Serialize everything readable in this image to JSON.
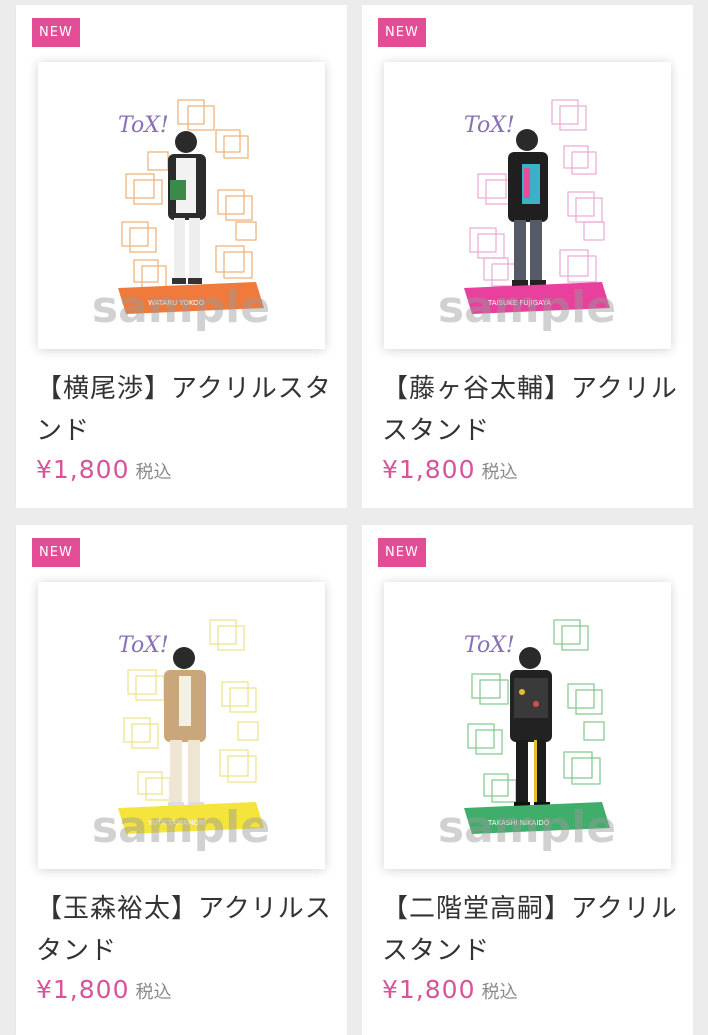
{
  "products": [
    {
      "badge": "NEW",
      "title": "【横尾渉】アクリルスタンド",
      "price": "¥1,800",
      "tax_label": "税込",
      "watermark": "sample",
      "stand_logo": "ToX!",
      "name_plate": "WATARU YOKOO",
      "accent_color": "#f07a3c",
      "pattern_color": "#e9a25d"
    },
    {
      "badge": "NEW",
      "title": "【藤ヶ谷太輔】アクリルスタンド",
      "price": "¥1,800",
      "tax_label": "税込",
      "watermark": "sample",
      "stand_logo": "ToX!",
      "name_plate": "TAISUKE FUJIGAYA",
      "accent_color": "#e8409c",
      "pattern_color": "#e59ad0"
    },
    {
      "badge": "NEW",
      "title": "【玉森裕太】アクリルスタンド",
      "price": "¥1,800",
      "tax_label": "税込",
      "watermark": "sample",
      "stand_logo": "ToX!",
      "name_plate": "YUTA TAMAMORI",
      "accent_color": "#f5e43c",
      "pattern_color": "#ece07a"
    },
    {
      "badge": "NEW",
      "title": "【二階堂高嗣】アクリルスタンド",
      "price": "¥1,800",
      "tax_label": "税込",
      "watermark": "sample",
      "stand_logo": "ToX!",
      "name_plate": "TAKASHI NIKAIDO",
      "accent_color": "#3fae6a",
      "pattern_color": "#6fc27d"
    }
  ]
}
